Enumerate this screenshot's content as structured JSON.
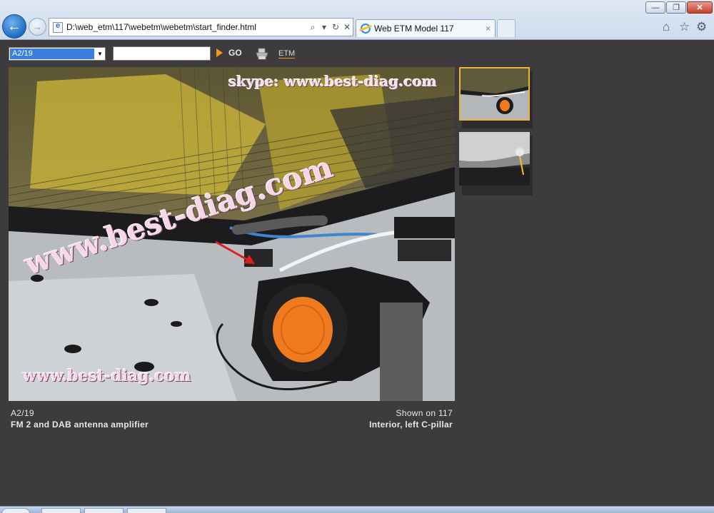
{
  "browser": {
    "address_url": "D:\\web_etm\\117\\webetm\\webetm\\start_finder.html",
    "tab_title": "Web ETM Model 117",
    "tab_close": "×",
    "back_glyph": "←",
    "forward_glyph": "→",
    "addr_search_glyph": "⌕",
    "addr_dropdown_glyph": "▾",
    "addr_refresh_glyph": "↻",
    "addr_stop_glyph": "✕",
    "min_glyph": "—",
    "max_glyph": "❐",
    "close_glyph": "✕",
    "home_glyph": "⌂",
    "favorites_glyph": "☆",
    "tools_glyph": "⚙"
  },
  "toolbar": {
    "component_select_value": "A2/19",
    "search_value": "",
    "go_label": "GO",
    "etm_link": "ETM"
  },
  "photo": {
    "watermark_top": "skype: www.best-diag.com",
    "watermark_mid": "www.best-diag.com",
    "watermark_bottom": "www.best-diag.com"
  },
  "caption": {
    "component_id": "A2/19",
    "description": "FM 2 and DAB antenna amplifier",
    "shown_on": "Shown on 117",
    "location": "Interior, left C-pillar"
  },
  "colors": {
    "page_bg": "#3d3b3e",
    "accent_orange": "#f39a1a",
    "selected_thumb_border": "#e7b63a",
    "select_highlight": "#3a7ee0"
  },
  "icons": {
    "print": "print-icon",
    "go_arrow": "go-arrow-icon",
    "ie_page": "ie-page-icon"
  }
}
